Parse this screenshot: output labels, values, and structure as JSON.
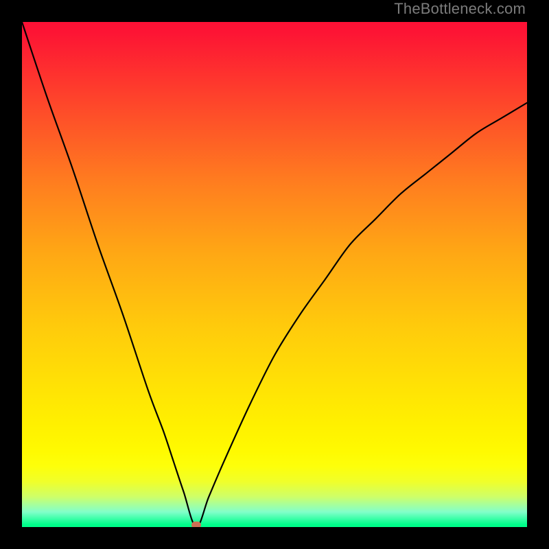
{
  "watermark": "TheBottleneck.com",
  "colors": {
    "frame": "#000000",
    "curve": "#000000",
    "marker": "#cc6f55"
  },
  "chart_data": {
    "type": "line",
    "title": "",
    "xlabel": "",
    "ylabel": "",
    "xlim": [
      0,
      100
    ],
    "ylim": [
      0,
      100
    ],
    "grid": false,
    "legend": false,
    "annotations": [],
    "background": "vertical-gradient red→orange→yellow→green (bottleneck scale)",
    "series": [
      {
        "name": "bottleneck-curve",
        "x": [
          0,
          5,
          10,
          15,
          20,
          25,
          28,
          30,
          32,
          34.5,
          37,
          40,
          45,
          50,
          55,
          60,
          65,
          70,
          75,
          80,
          85,
          90,
          95,
          100
        ],
        "values": [
          100,
          85,
          71,
          56,
          42,
          27,
          19,
          13,
          7,
          0,
          6,
          13,
          24,
          34,
          42,
          49,
          56,
          61,
          66,
          70,
          74,
          78,
          81,
          84
        ]
      }
    ],
    "marker": {
      "x": 34.5,
      "y": 0
    }
  }
}
